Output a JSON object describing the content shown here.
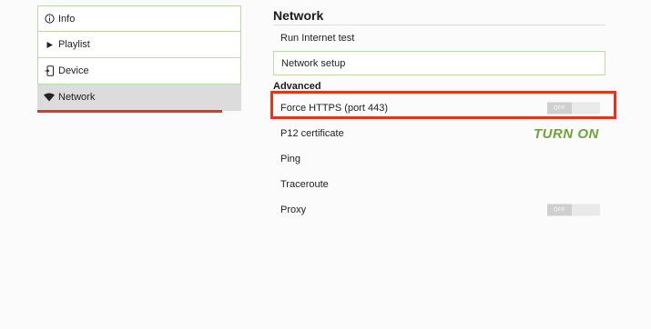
{
  "sidebar": {
    "items": [
      {
        "label": "Info",
        "icon": "info-circle-icon"
      },
      {
        "label": "Playlist",
        "icon": "play-triangle-icon"
      },
      {
        "label": "Device",
        "icon": "device-icon"
      },
      {
        "label": "Network",
        "icon": "wifi-icon",
        "active": true
      }
    ]
  },
  "main": {
    "title": "Network",
    "run_test": "Run Internet test",
    "network_setup": "Network setup",
    "advanced_heading": "Advanced",
    "force_https": {
      "label": "Force HTTPS (port 443)",
      "state": "OFF"
    },
    "p12": "P12 certificate",
    "ping": "Ping",
    "traceroute": "Traceroute",
    "proxy": {
      "label": "Proxy",
      "state": "OFF"
    }
  },
  "annotation": {
    "callout": "TURN ON",
    "highlight_color": "#e8331b",
    "callout_color": "#6aa734"
  },
  "colors": {
    "border_green": "#b9dcaa",
    "active_bg": "#dcdcdc",
    "accent_red": "#e8331b"
  }
}
